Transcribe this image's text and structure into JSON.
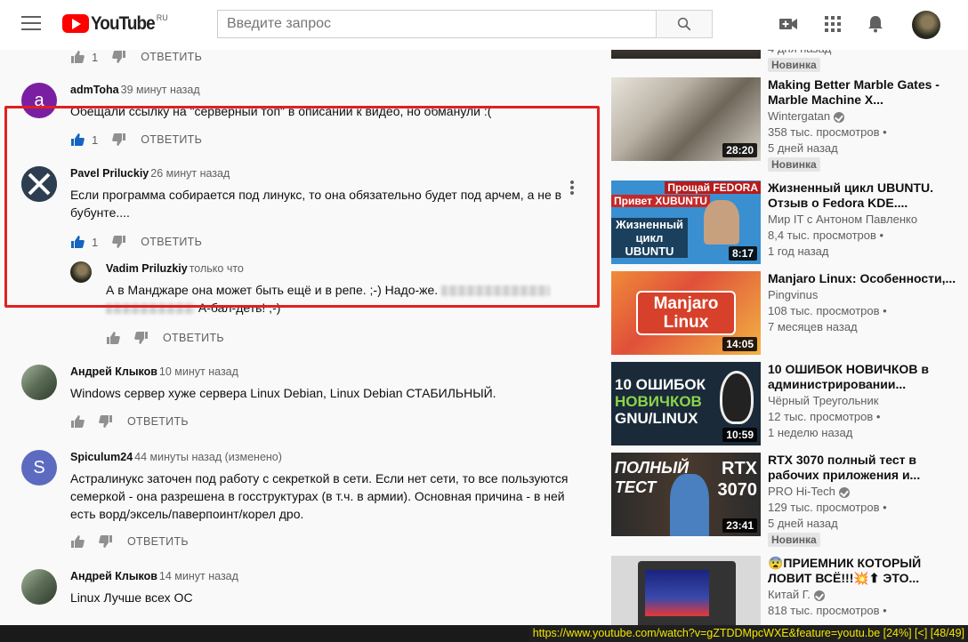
{
  "header": {
    "logo_text": "YouTube",
    "logo_region": "RU",
    "search_placeholder": "Введите запрос"
  },
  "comments": [
    {
      "author": "",
      "time": "",
      "text": "",
      "likes": "1",
      "reply": "ОТВЕТИТЬ"
    },
    {
      "avatar_letter": "a",
      "avatar_color": "#7b1fa2",
      "author": "admToha",
      "time": "39 минут назад",
      "text": "Обещали ссылку на \"серверный топ\" в описании к видео, но обманули :(",
      "likes": "1",
      "reply": "ОТВЕТИТЬ"
    },
    {
      "author": "Pavel Priluckiy",
      "time": "26 минут назад",
      "text": "Если программа собирается под линукс, то она обязательно будет под арчем, а не в бубунте....",
      "likes": "1",
      "reply": "ОТВЕТИТЬ"
    },
    {
      "author": "Vadim Priluzkiy",
      "time": "только что",
      "text_part1": "А в Манджаре она может быть ещё и в репе. ;-) Надо-же.",
      "text_part2": "А-бал-деть! ;-)",
      "reply": "ОТВЕТИТЬ"
    },
    {
      "author": "Андрей Клыков",
      "time": "10 минут назад",
      "text": "Windows сервер хуже сервера Linux Debian, Linux Debian СТАБИЛЬНЫЙ.",
      "reply": "ОТВЕТИТЬ"
    },
    {
      "avatar_letter": "S",
      "avatar_color": "#5c6bc0",
      "author": "Spiculum24",
      "time": "44 минуты назад (изменено)",
      "text": "Астралинукс заточен под работу с секреткой в сети. Если нет сети, то все пользуются семеркой - она разрешена в госструктурах (в т.ч. в армии). Основная причина - в ней есть ворд/эксель/паверпоинт/корел дро.",
      "reply": "ОТВЕТИТЬ"
    },
    {
      "author": "Андрей Клыков",
      "time": "14 минут назад",
      "text": "Linux Лучше всех ОС",
      "reply": "ОТВЕТИТЬ"
    }
  ],
  "sidebar": [
    {
      "title": "",
      "channel": "",
      "line1": "",
      "line2": "4 дня назад",
      "badge": "Новинка",
      "duration": ""
    },
    {
      "title": "Making Better Marble Gates - Marble Machine X...",
      "channel": "Wintergatan",
      "verified": true,
      "line1": "358 тыс. просмотров •",
      "line2": "5 дней назад",
      "badge": "Новинка",
      "duration": "28:20"
    },
    {
      "title": "Жизненный цикл UBUNTU. Отзыв о Fedora KDE....",
      "channel": "Мир IT с Антоном Павленко",
      "line1": "8,4 тыс. просмотров •",
      "line2": "1 год назад",
      "duration": "8:17",
      "thumb_top": "Прощай FEDORA",
      "thumb_mid": "Привет XUBUNTU",
      "thumb_bottom": "Жизненный цикл UBUNTU"
    },
    {
      "title": "Manjaro Linux: Особенности,...",
      "channel": "Pingvinus",
      "line1": "108 тыс. просмотров •",
      "line2": "7 месяцев назад",
      "duration": "14:05",
      "thumb_text": "Manjaro Linux"
    },
    {
      "title": "10 ОШИБОК НОВИЧКОВ в администрировании...",
      "channel": "Чёрный Треугольник",
      "line1": "12 тыс. просмотров •",
      "line2": "1 неделю назад",
      "duration": "10:59",
      "thumb_line1": "10 ОШИБОК",
      "thumb_line2": "НОВИЧКОВ",
      "thumb_line3": "GNU/LINUX"
    },
    {
      "title": "RTX 3070 полный тест в рабочих приложения и...",
      "channel": "PRO Hi-Tech",
      "verified": true,
      "line1": "129 тыс. просмотров •",
      "line2": "5 дней назад",
      "badge": "Новинка",
      "duration": "23:41",
      "thumb_left": "ПОЛНЫЙ ТЕСТ",
      "thumb_right": "RTX 3070"
    },
    {
      "title": "😨ПРИЕМНИК КОТОРЫЙ ЛОВИТ ВСЁ!!!💥⬆ ЭТО...",
      "channel": "Китай Г.",
      "verified": true,
      "line1": "818 тыс. просмотров •",
      "line2": "",
      "duration": ""
    }
  ],
  "statusbar": {
    "text": "https://www.youtube.com/watch?v=gZTDDMpcWXE&feature=youtu.be [24%] [<] [48/49]"
  }
}
